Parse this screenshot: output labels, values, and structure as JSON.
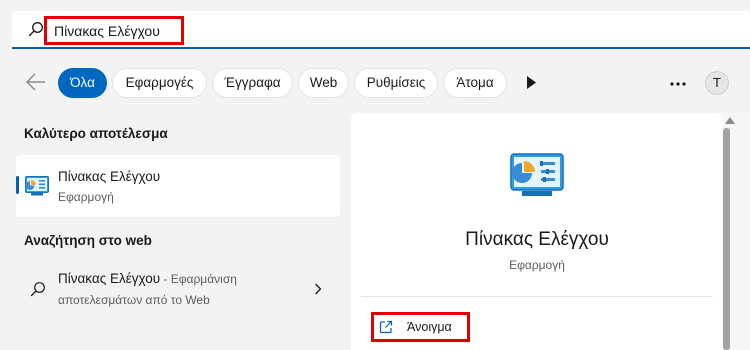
{
  "search": {
    "value": "Πίνακας Ελέγχου",
    "icon": "search-icon"
  },
  "filters": {
    "back_icon": "back-arrow-icon",
    "chips": [
      {
        "label": "Όλα",
        "active": true
      },
      {
        "label": "Εφαρμογές",
        "active": false
      },
      {
        "label": "Έγγραφα",
        "active": false
      },
      {
        "label": "Web",
        "active": false
      },
      {
        "label": "Ρυθμίσεις",
        "active": false
      },
      {
        "label": "Άτομα",
        "active": false
      }
    ],
    "play_icon": "play-icon",
    "more_icon": "more-icon",
    "avatar_initial": "T"
  },
  "best_match": {
    "heading": "Καλύτερο αποτέλεσμα",
    "title": "Πίνακας Ελέγχου",
    "subtitle": "Εφαρμογή",
    "icon": "control-panel-icon"
  },
  "web_search": {
    "heading": "Αναζήτηση στο web",
    "query": "Πίνακας Ελέγχου",
    "suffix": " - Εφαρμάνιση",
    "line2": "αποτελεσμάτων από το Web",
    "icon": "web-search-icon"
  },
  "preview": {
    "title": "Πίνακας Ελέγχου",
    "subtitle": "Εφαρμογή",
    "open_label": "Άνοιγμα",
    "open_icon": "open-external-icon"
  },
  "colors": {
    "accent": "#0067c0",
    "highlight_box": "#e00000"
  }
}
